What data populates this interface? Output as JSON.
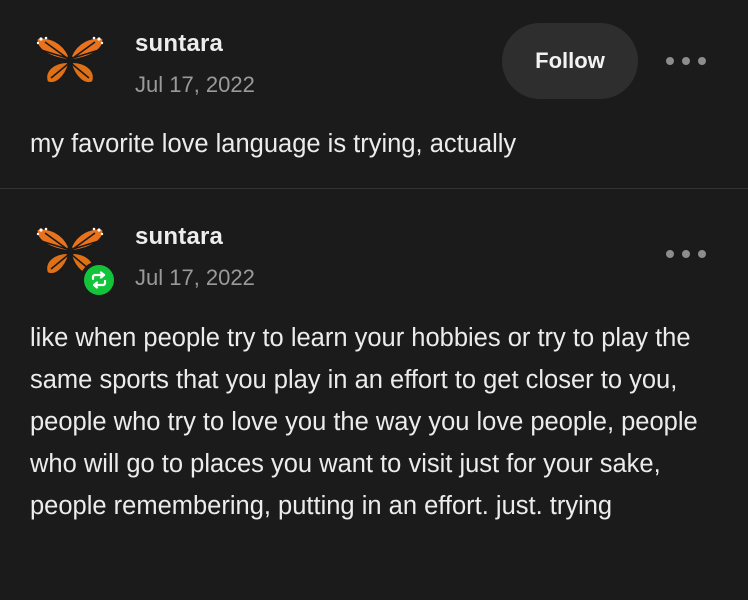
{
  "posts": [
    {
      "username": "suntara",
      "date": "Jul 17, 2022",
      "follow_label": "Follow",
      "text": "my favorite love language is trying, actually",
      "avatar_icon": "monarch-butterfly-icon"
    },
    {
      "username": "suntara",
      "date": "Jul 17, 2022",
      "reblog_icon": "reblog-icon",
      "text": "like when people try to learn your hobbies or try to play the same sports that you play in an effort to get closer to you, people who try to love you the way you love people, people who will go to places you want to visit just for your sake, people remembering, putting in an effort. just. trying",
      "avatar_icon": "monarch-butterfly-icon"
    }
  ],
  "colors": {
    "background": "#1b1b1b",
    "text": "#ececec",
    "muted": "#9a9a9a",
    "button_bg": "#2e2e2e",
    "reblog_green": "#13c43a",
    "butterfly_orange": "#e8731c"
  }
}
